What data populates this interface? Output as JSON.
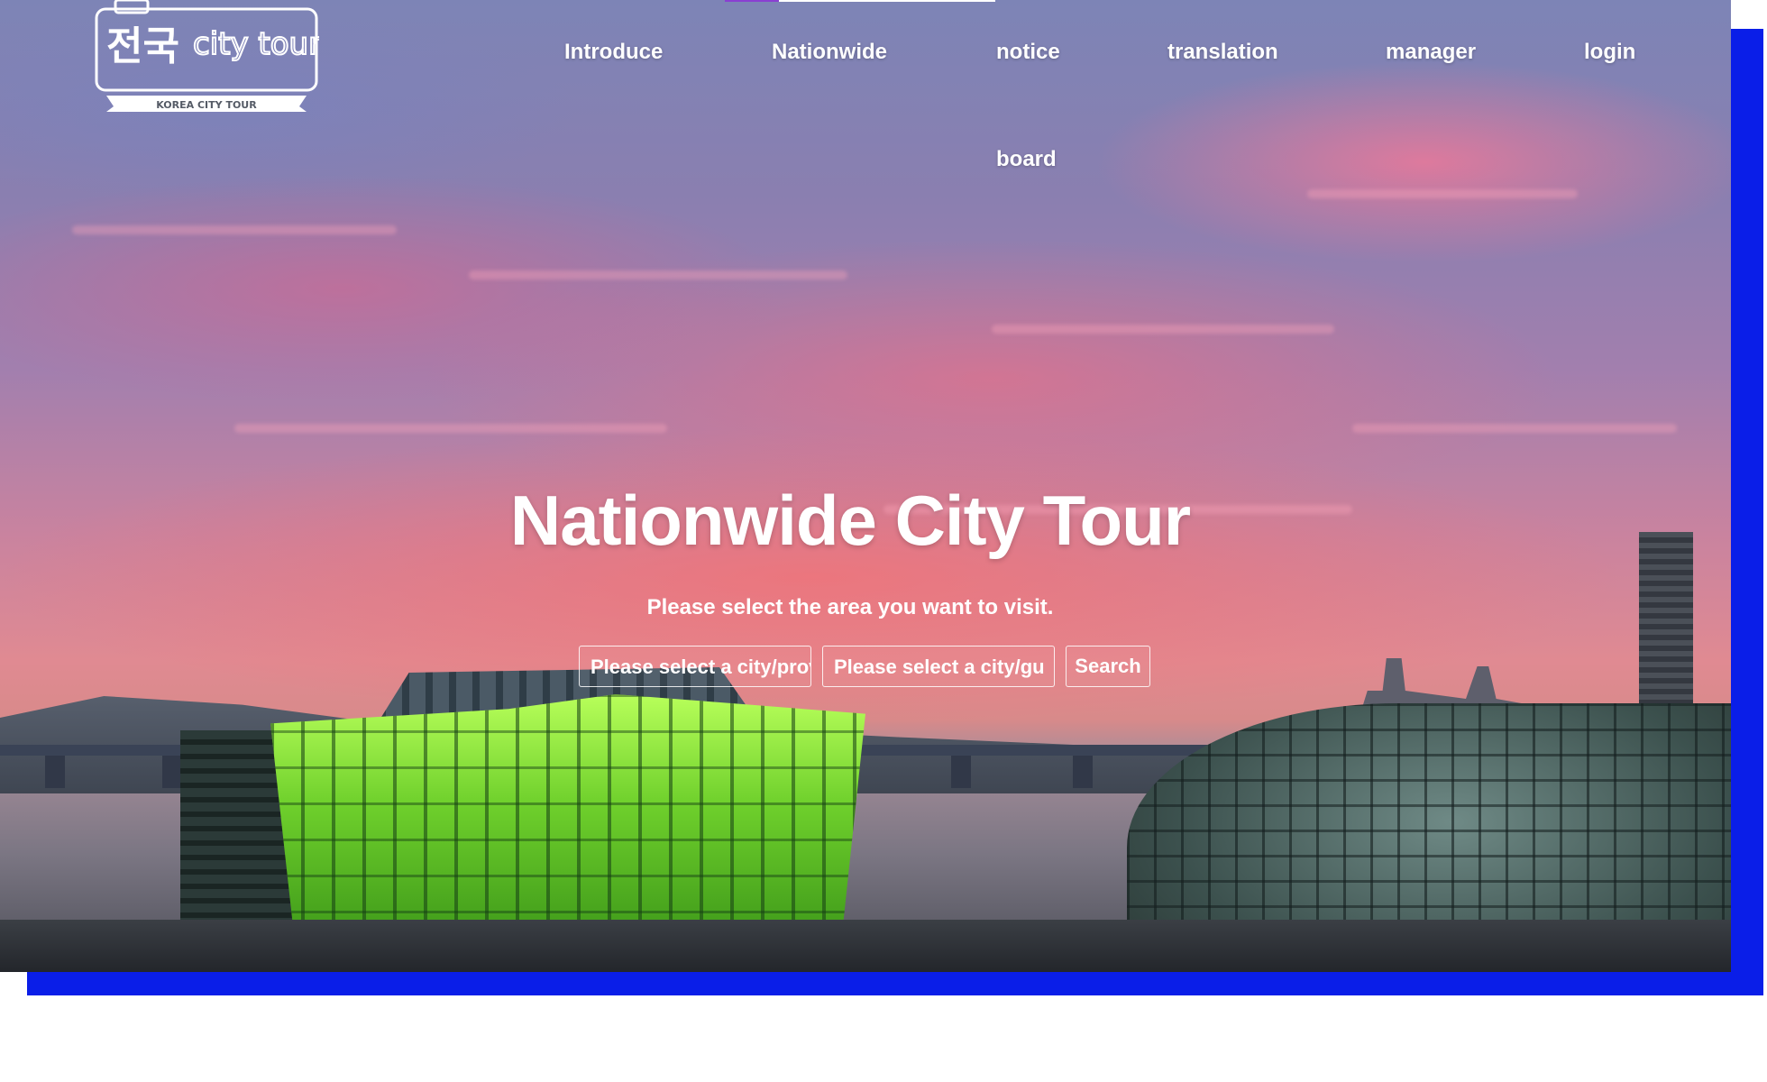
{
  "logo": {
    "korean_text": "전국",
    "latin_text": "city tour",
    "banner_text": "KOREA CITY TOUR"
  },
  "nav": {
    "items": [
      {
        "label": "Introduce"
      },
      {
        "label": "Nationwide"
      },
      {
        "label": "notice"
      },
      {
        "label": "translation"
      },
      {
        "label": "manager"
      },
      {
        "label": "login"
      },
      {
        "label": "board"
      }
    ]
  },
  "hero": {
    "title": "Nationwide City Tour",
    "subtitle": "Please select the area you want to visit.",
    "select_1": "Please select a city/province",
    "select_2": "Please select a city/gu",
    "search_label": "Search"
  },
  "colors": {
    "frame_blue": "#0a1ee8",
    "text": "#ffffff",
    "accent_purple": "#8a3fd1"
  }
}
